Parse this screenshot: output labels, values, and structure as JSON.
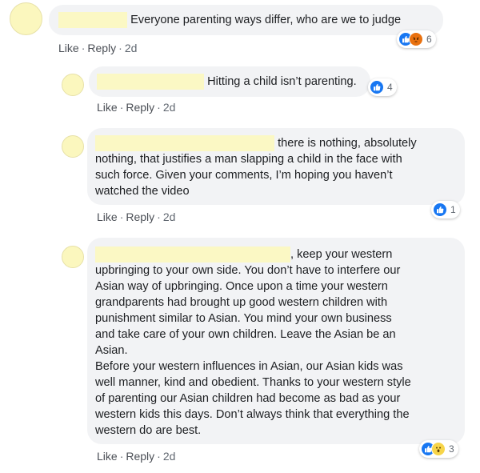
{
  "comments": [
    {
      "text": "Everyone parenting ways differ, who are we to judge",
      "actions": {
        "like": "Like",
        "reply": "Reply",
        "time": "2d"
      },
      "reactions": {
        "icons": [
          "like-icon",
          "angry-icon"
        ],
        "count": "6"
      }
    },
    {
      "text": "Hitting a child isn’t parenting.",
      "actions": {
        "like": "Like",
        "reply": "Reply",
        "time": "2d"
      },
      "reactions": {
        "icons": [
          "like-icon"
        ],
        "count": "4"
      }
    },
    {
      "lines": [
        "there is nothing, absolutely",
        "nothing, that justifies a man slapping a child in the face with",
        "such force. Given your comments, I’m hoping you haven’t",
        "watched the video"
      ],
      "actions": {
        "like": "Like",
        "reply": "Reply",
        "time": "2d"
      },
      "reactions": {
        "icons": [
          "like-icon"
        ],
        "count": "1"
      }
    },
    {
      "lines": [
        ", keep your western",
        "upbringing to your own side. You don’t have to interfere our",
        "Asian way of upbringing. Once upon a time your western",
        "grandparents had brought up good western children with",
        "punishment similar to Asian. You mind your own business",
        "and take care of your own children. Leave the Asian be an",
        "Asian.",
        "Before your western influences in Asian, our Asian kids was",
        "well manner, kind and obedient. Thanks to your western style",
        "of parenting our Asian children had become as bad as your",
        "western kids this days. Don’t always think that everything the",
        "western do are best."
      ],
      "actions": {
        "like": "Like",
        "reply": "Reply",
        "time": "2d"
      },
      "reactions": {
        "icons": [
          "like-icon",
          "wow-icon"
        ],
        "count": "3"
      }
    }
  ],
  "separator": "·",
  "colors": {
    "bubble": "#f2f3f5",
    "redaction": "#fbf8c4",
    "like": "#1877f2",
    "angry": "#e9710f",
    "wow": "#f7d54a",
    "meta": "#606770"
  }
}
